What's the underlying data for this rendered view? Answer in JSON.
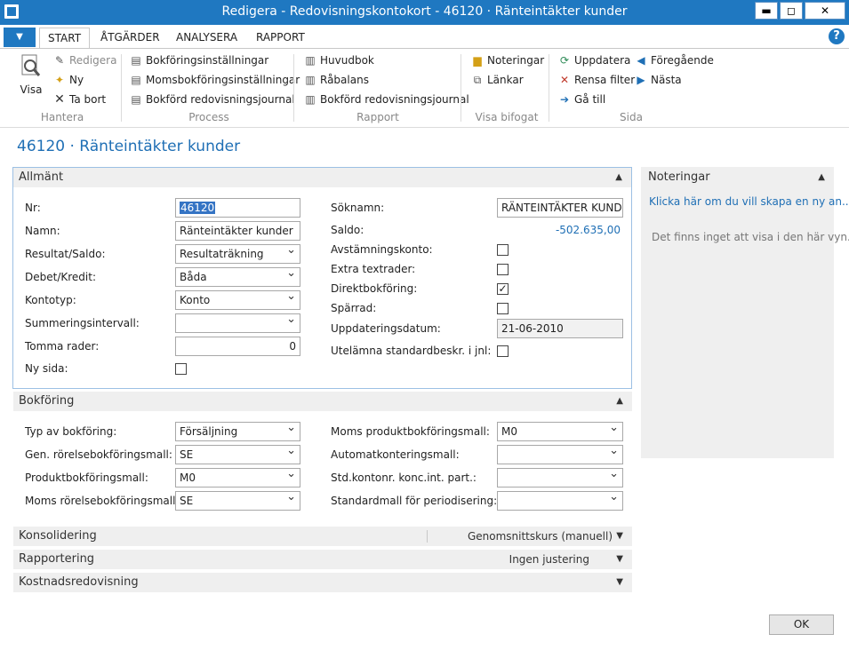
{
  "window": {
    "title": "Redigera - Redovisningskontokort - 46120 · Ränteintäkter kunder",
    "minimize": "▬",
    "maximize": "◻",
    "close": "✕"
  },
  "ribbon": {
    "menu_label": "▼",
    "tabs": [
      "START",
      "ÅTGÄRDER",
      "ANALYSERA",
      "RAPPORT"
    ],
    "help": "?",
    "groups": {
      "hantera": {
        "label": "Hantera",
        "visa": "Visa",
        "redigera": "Redigera",
        "ny": "Ny",
        "ta_bort": "Ta bort"
      },
      "process": {
        "label": "Process",
        "items": [
          "Bokföringsinställningar",
          "Momsbokföringsinställningar",
          "Bokförd redovisningsjournal"
        ]
      },
      "rapport": {
        "label": "Rapport",
        "items": [
          "Huvudbok",
          "Råbalans",
          "Bokförd redovisningsjournal"
        ]
      },
      "visa_bifogat": {
        "label": "Visa bifogat",
        "items": [
          "Noteringar",
          "Länkar"
        ]
      },
      "sida": {
        "label": "Sida",
        "items": [
          "Uppdatera",
          "Rensa filter",
          "Gå till",
          "Föregående",
          "Nästa"
        ]
      }
    }
  },
  "page_title": "46120 · Ränteintäkter kunder",
  "allmant": {
    "header": "Allmänt",
    "left": {
      "nr_label": "Nr:",
      "nr_value": "46120",
      "namn_label": "Namn:",
      "namn_value": "Ränteintäkter kunder",
      "resultat_label": "Resultat/Saldo:",
      "resultat_value": "Resultaträkning",
      "debet_label": "Debet/Kredit:",
      "debet_value": "Båda",
      "kontotyp_label": "Kontotyp:",
      "kontotyp_value": "Konto",
      "summering_label": "Summeringsintervall:",
      "summering_value": "",
      "tomma_label": "Tomma rader:",
      "tomma_value": "0",
      "nysida_label": "Ny sida:"
    },
    "right": {
      "soknamn_label": "Söknamn:",
      "soknamn_value": "RÄNTEINTÄKTER KUND...",
      "saldo_label": "Saldo:",
      "saldo_value": "-502.635,00",
      "avstamning_label": "Avstämningskonto:",
      "extra_label": "Extra textrader:",
      "direkt_label": "Direktbokföring:",
      "sparrad_label": "Spärrad:",
      "uppdatering_label": "Uppdateringsdatum:",
      "uppdatering_value": "21-06-2010",
      "utelamna_label": "Utelämna standardbeskr. i jnl:",
      "check_mark": "✓"
    }
  },
  "bokforing": {
    "header": "Bokföring",
    "typ_label": "Typ av bokföring:",
    "typ_value": "Försäljning",
    "gen_label": "Gen. rörelsebokföringsmall:",
    "gen_value": "SE",
    "produkt_label": "Produktbokföringsmall:",
    "produkt_value": "M0",
    "momsrorelse_label": "Moms rörelsebokföringsmall:",
    "momsrorelse_value": "SE",
    "momsprodukt_label": "Moms produktbokföringsmall:",
    "momsprodukt_value": "M0",
    "automat_label": "Automatkonteringsmall:",
    "automat_value": "",
    "std_label": "Std.kontonr. konc.int. part.:",
    "std_value": "",
    "standardmall_label": "Standardmall för periodisering:",
    "standardmall_value": ""
  },
  "konsolidering": {
    "header": "Konsolidering",
    "summary": "Genomsnittskurs (manuell)"
  },
  "rapportering": {
    "header": "Rapportering",
    "summary": "Ingen justering"
  },
  "kostnad": {
    "header": "Kostnadsredovisning"
  },
  "noteringar": {
    "header": "Noteringar",
    "link": "Klicka här om du vill skapa en ny an...",
    "empty": "Det finns inget att visa i den här vyn."
  },
  "ok_label": "OK",
  "colors": {
    "accent": "#1f78c1",
    "link": "#1f6fb5",
    "header_bg": "#efefef"
  }
}
